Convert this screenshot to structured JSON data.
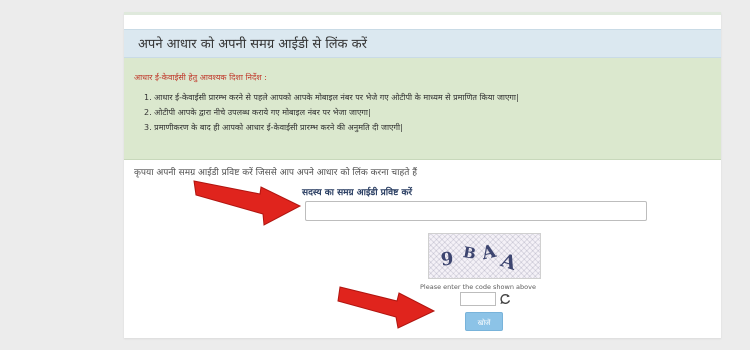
{
  "card": {
    "header_title": "अपने आधार को अपनी समग्र आईडी से लिंक करें"
  },
  "instructions": {
    "title": "आधार ई-केवाईसी हेतु आवश्यक दिशा निर्देश :",
    "items": [
      "1. आधार ई-केवाईसी प्रारम्भ करने से पहले आपको आपके मोबाइल नंबर पर भेजे गए ओटीपी के माध्यम से प्रमाणित किया जाएगा|",
      "2. ओटीपी आपके द्वारा नीचे उपलब्ध कराये गए मोबाइल नंबर पर भेजा जाएगा|",
      "3. प्रमाणीकरण के बाद ही आपको आधार ई-केवाईसी प्रारम्भ करने की अनुमति दी जाएगी|"
    ]
  },
  "form": {
    "prompt": "कृपया अपनी समग्र आईडी प्रविष्ट करें जिससे आप अपने आधार को लिंक करना चाहते हैं",
    "id_label": "सदस्य का समग्र आईडी प्रविष्ट करें",
    "id_input_value": "",
    "captcha_text": [
      "9",
      "B",
      "A",
      "A"
    ],
    "captcha_caption": "Please enter the code shown above",
    "captcha_entry_value": "",
    "search_button": "खोजें"
  },
  "icons": {
    "refresh": "refresh-icon",
    "arrow": "red-arrow-annotation"
  },
  "colors": {
    "header_bg": "#dbe8f0",
    "instructions_bg": "#dbe8ce",
    "instructions_title": "#c0392b",
    "label": "#2b3f63",
    "button": "#8cc3e7",
    "arrow": "#e0241d"
  }
}
